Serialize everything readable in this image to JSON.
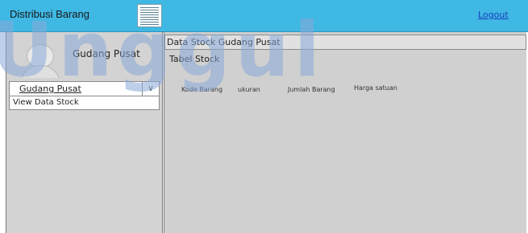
{
  "header": {
    "app_title": "Distribusi Barang",
    "logout_label": "Logout"
  },
  "watermark": "Unggul",
  "sidebar": {
    "user_name": "Gudang Pusat",
    "selected_option": "Gudang Pusat",
    "menu_items": [
      {
        "label": "View Data Stock"
      }
    ]
  },
  "main": {
    "breadcrumb": "Data Stock Gudang Pusat",
    "section_title": "Tabel Stock",
    "table": {
      "columns": [
        "Kode Barang",
        "ukuran",
        "Jumlah Barang",
        "Harga satuan"
      ],
      "rows": []
    }
  },
  "colors": {
    "topbar": "#3fb8e4",
    "panel": "#d3d3d3",
    "link": "#1a3fbf"
  }
}
